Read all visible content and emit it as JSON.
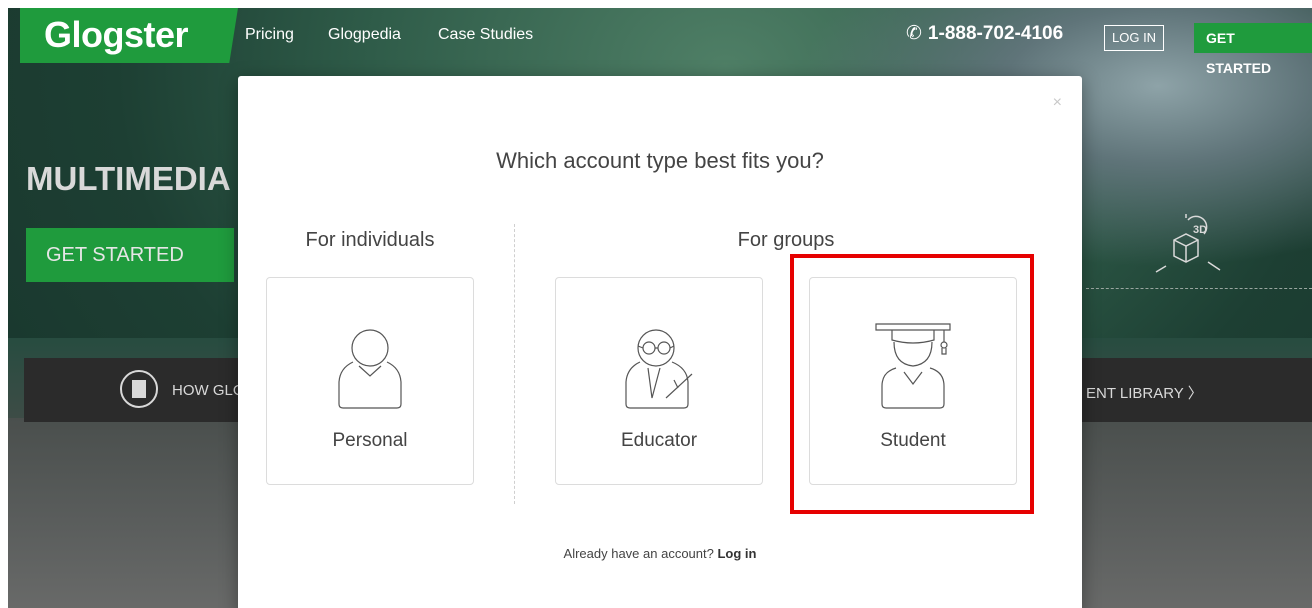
{
  "nav": {
    "logo": "Glogster",
    "links": [
      "Pricing",
      "Glogpedia",
      "Case Studies"
    ],
    "phone": "1-888-702-4106",
    "login": "LOG IN",
    "get_started": "GET STARTED"
  },
  "hero": {
    "headline": "MULTIMEDIA",
    "cta": "GET STARTED",
    "band_left": "HOW GLO",
    "band_right": "ENT LIBRARY  〉"
  },
  "modal": {
    "close": "×",
    "title": "Which account type best fits you?",
    "individuals_heading": "For individuals",
    "groups_heading": "For groups",
    "cards": [
      {
        "label": "Personal",
        "icon": "person-icon"
      },
      {
        "label": "Educator",
        "icon": "educator-icon"
      },
      {
        "label": "Student",
        "icon": "student-icon"
      }
    ],
    "footer_prefix": "Already have an account? ",
    "footer_link": "Log in"
  },
  "colors": {
    "brand_green": "#1f9b3d",
    "highlight_red": "#e60000"
  }
}
